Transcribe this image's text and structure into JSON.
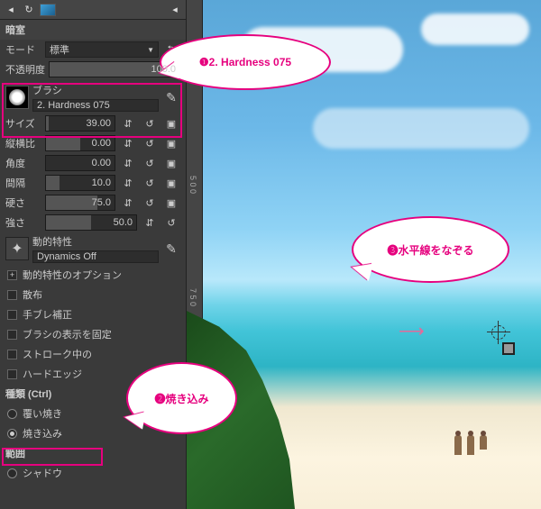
{
  "toolbar": {
    "icon1": "◂",
    "icon2": "↻",
    "icon_right": "◂"
  },
  "header": {
    "darkroom": "暗室"
  },
  "mode": {
    "label": "モード",
    "value": "標準",
    "apply_icon": "⮌"
  },
  "opacity": {
    "label": "不透明度",
    "value": "100.0"
  },
  "brush": {
    "section": "ブラシ",
    "name": "2. Hardness 075",
    "size_label": "サイズ",
    "size_value": "39.00"
  },
  "props": {
    "aspect_label": "縦横比",
    "aspect_value": "0.00",
    "angle_label": "角度",
    "angle_value": "0.00",
    "spacing_label": "間隔",
    "spacing_value": "10.0",
    "hardness_label": "硬さ",
    "hardness_value": "75.0",
    "force_label": "強さ",
    "force_value": "50.0"
  },
  "dynamics": {
    "label": "動的特性",
    "value": "Dynamics Off",
    "options_label": "動的特性のオプション"
  },
  "checks": {
    "scatter": "散布",
    "smooth": "手ブレ補正",
    "lock_brush": "ブラシの表示を固定",
    "while_stroke": "ストローク中の",
    "hard_edge": "ハードエッジ"
  },
  "type": {
    "section": "種類 (Ctrl)",
    "dodge": "覆い焼き",
    "burn": "焼き込み"
  },
  "range": {
    "section": "範囲",
    "shadow": "シャドウ"
  },
  "callouts": {
    "c1": "❶2. Hardness 075",
    "c2": "❷焼き込み",
    "c3": "❸水平線をなぞる"
  },
  "ruler": {
    "t500": "5\n0\n0",
    "t750": "7\n5\n0"
  },
  "arrow": "⟶",
  "stepper": "⇵"
}
